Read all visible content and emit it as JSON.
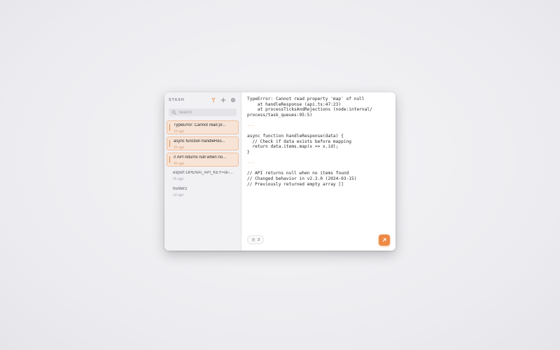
{
  "sidebar": {
    "app_title": "STASH",
    "search": {
      "placeholder": "Search",
      "value": ""
    },
    "items": [
      {
        "title": "TypeError: Cannot read pr...",
        "time": "1h ago",
        "highlighted": true
      },
      {
        "title": "async function handleRes...",
        "time": "2h ago",
        "highlighted": true
      },
      {
        "title": "// API returns null when no...",
        "time": "4h ago",
        "highlighted": true
      },
      {
        "title": "export OPENAI_API_KEY=sk-...",
        "time": "9h ago",
        "highlighted": false
      },
      {
        "title": "hunter2",
        "time": "1d ago",
        "highlighted": false
      }
    ]
  },
  "main": {
    "code_lines": [
      "TypeError: Cannot read property 'map' of null",
      "    at handleResponse (api.ts:47:23)",
      "    at processTicksAndRejections (node:internal/",
      "process/task_queues:95:5)",
      "",
      "---",
      "",
      "async function handleResponse(data) {",
      "  // Check if data exists before mapping",
      "  return data.items.map(x => x.id);",
      "}",
      "",
      "---",
      "",
      "// API returns null when no items found",
      "// Changed behavior in v2.3.0 (2024-03-15)",
      "// Previously returned empty array []"
    ],
    "count": "3"
  },
  "colors": {
    "accent": "#ec8a45",
    "highlight_bg": "#f7e4d6",
    "highlight_border": "#efbf9e",
    "separator": "#e7a57a"
  },
  "icons": {
    "merge": "merge-icon",
    "add": "plus-icon",
    "settings": "gear-icon",
    "search": "search-icon",
    "count": "hand-icon",
    "open": "arrow-up-right-icon"
  }
}
